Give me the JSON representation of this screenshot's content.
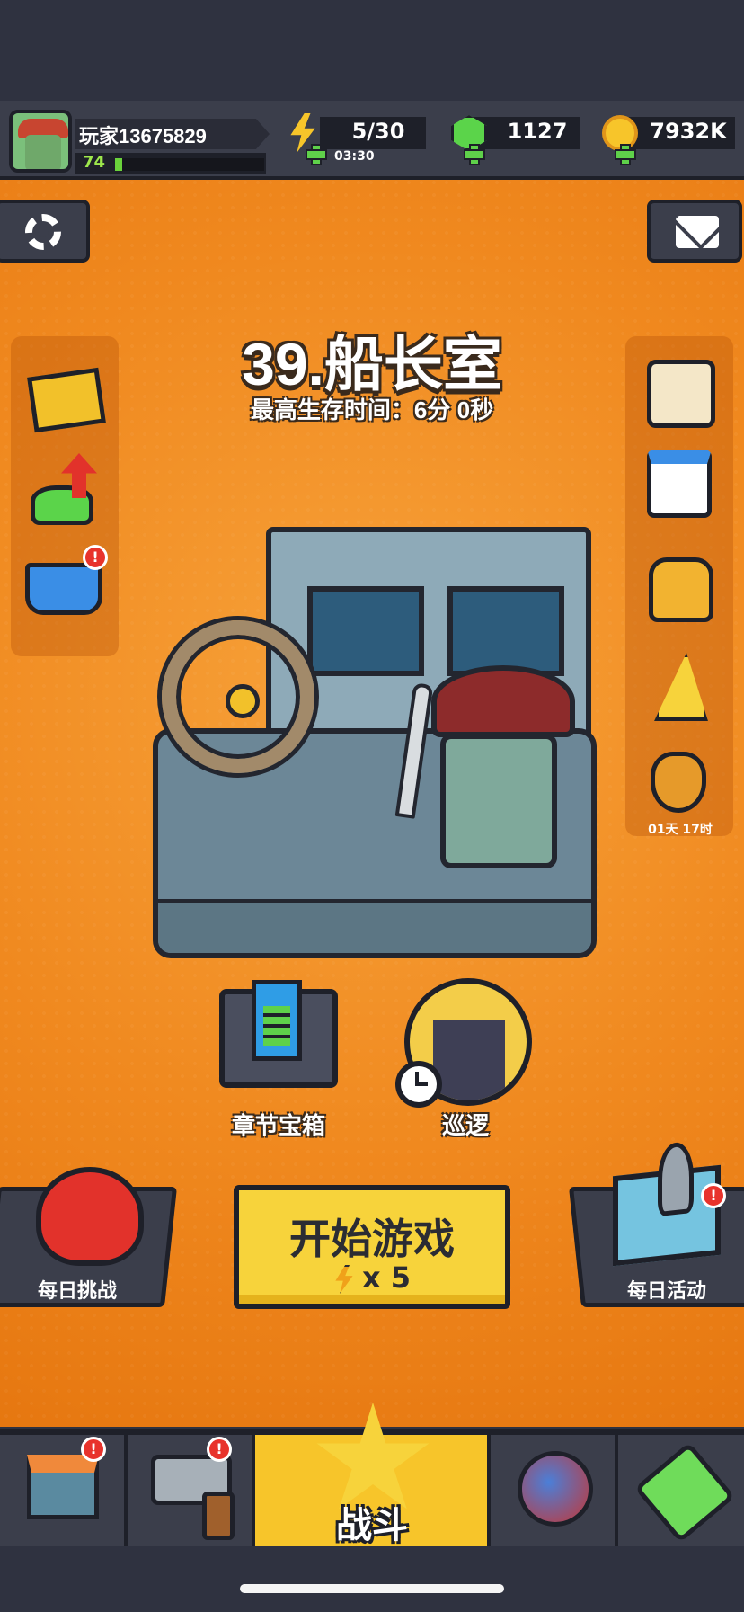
{
  "player": {
    "name": "玩家13675829",
    "level": "74",
    "xp_fraction": 0.05
  },
  "resources": {
    "energy": "5/30",
    "energy_timer": "03:30",
    "gems": "1127",
    "coins": "7932K"
  },
  "level": {
    "title": "39.船长室",
    "best_time": "最高生存时间：6分 0秒"
  },
  "side_right": {
    "timer": "01天 17时"
  },
  "badges": {
    "alert": "!"
  },
  "chest": {
    "label": "章节宝箱"
  },
  "patrol": {
    "label": "巡逻"
  },
  "actions": {
    "daily_challenge": "每日挑战",
    "daily_event": "每日活动",
    "start_label": "开始游戏",
    "start_cost": "x 5"
  },
  "nav": {
    "battle": "战斗"
  },
  "colors": {
    "background_orange": "#f0891f",
    "panel_dark": "#3b3e4b",
    "accent_yellow": "#f7d33b",
    "gem_green": "#5bd44a",
    "badge_red": "#e8332c"
  }
}
